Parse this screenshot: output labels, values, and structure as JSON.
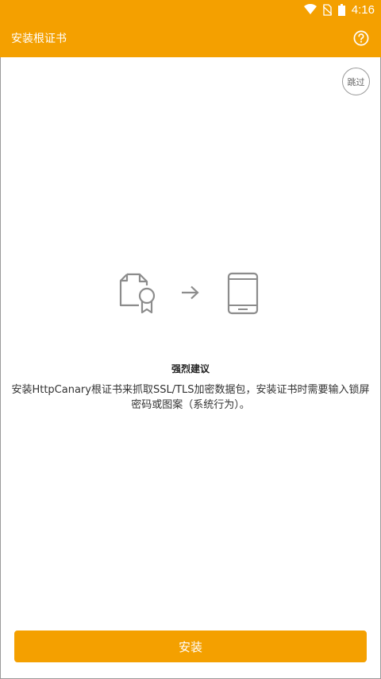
{
  "status_bar": {
    "time": "4:16",
    "icons": [
      "wifi-icon",
      "no-sim-icon",
      "battery-icon"
    ]
  },
  "app_bar": {
    "title": "安装根证书",
    "help_icon": "help-icon"
  },
  "skip_label": "跳过",
  "illustration": {
    "left_icon": "certificate-icon",
    "middle_icon": "arrow-right-icon",
    "right_icon": "phone-icon"
  },
  "heading": "强烈建议",
  "description": "安装HttpCanary根证书来抓取SSL/TLS加密数据包，安装证书时需要输入锁屏密码或图案（系统行为）。",
  "install_button_label": "安装",
  "colors": {
    "accent": "#f4a000",
    "icon_gray": "#8c8c8c"
  }
}
